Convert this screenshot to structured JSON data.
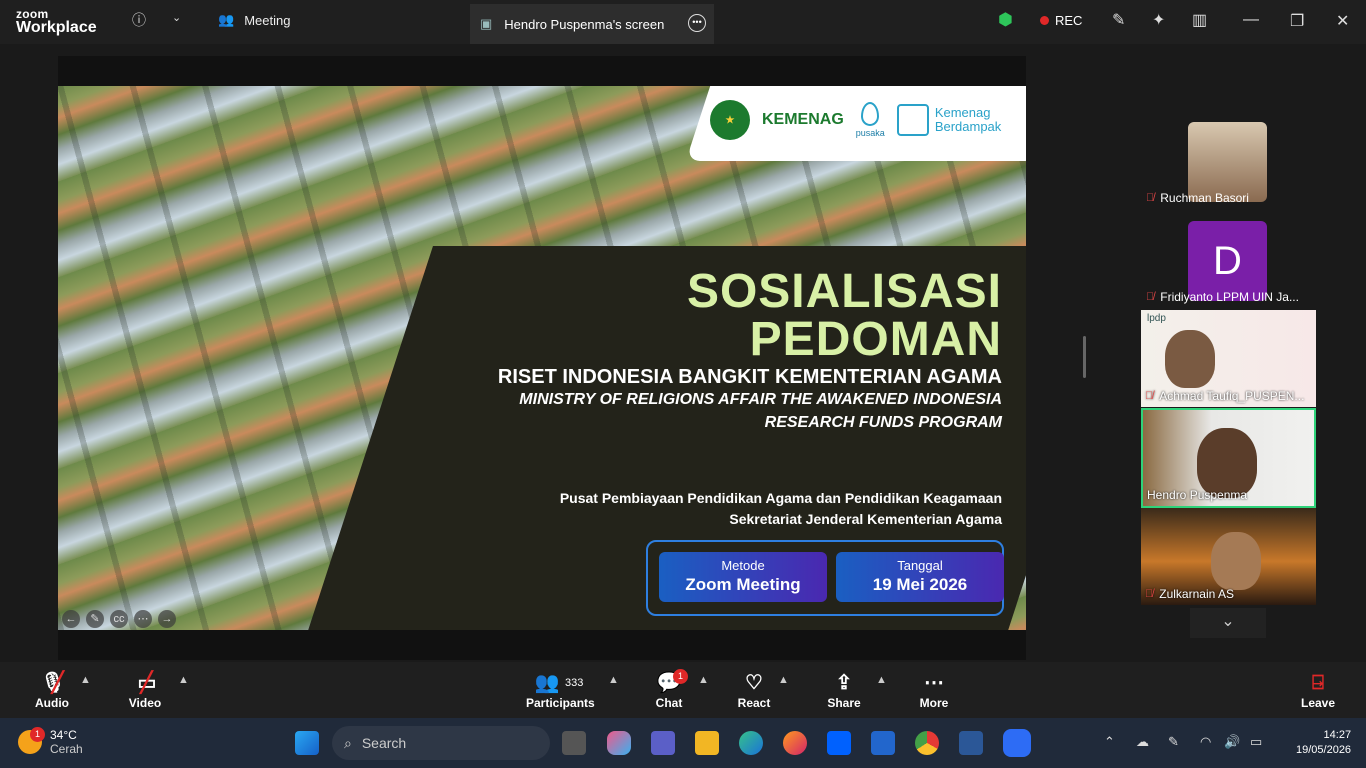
{
  "app": {
    "brand_line1": "zoom",
    "brand_line2": "Workplace"
  },
  "topbar": {
    "info_icon": "info-icon",
    "meeting_tab": "Meeting",
    "screen_tab": "Hendro Puspenma's screen",
    "rec_label": "REC"
  },
  "slide": {
    "logo_kemenag": "KEMENAG",
    "logo_pusaka": "pusaka",
    "logo_berdampak_1": "Kemenag",
    "logo_berdampak_2": "Berdampak",
    "title_line1": "SOSIALISASI",
    "title_line2": "PEDOMAN",
    "subtitle": "RISET INDONESIA BANGKIT KEMENTERIAN AGAMA",
    "subtitle_en_1": "MINISTRY OF RELIGIONS AFFAIR THE AWAKENED INDONESIA",
    "subtitle_en_2": "RESEARCH FUNDS PROGRAM",
    "org_1": "Pusat Pembiayaan Pendidikan Agama dan Pendidikan Keagamaan",
    "org_2": "Sekretariat Jenderal Kementerian Agama",
    "method_key": "Metode",
    "method_value": "Zoom Meeting",
    "date_key": "Tanggal",
    "date_value": "19 Mei 2026"
  },
  "participants_panel": [
    {
      "name": "Ruchman Basori"
    },
    {
      "name": "Fridiyanto LPPM UIN Ja...",
      "initial": "D"
    },
    {
      "name": "Achmad Taufiq_PUSPEN...",
      "bg_text": "lpdp"
    },
    {
      "name": "Hendro Puspenma"
    },
    {
      "name": "Zulkarnain AS"
    }
  ],
  "toolbar": {
    "audio": "Audio",
    "video": "Video",
    "participants": "Participants",
    "participants_count": "333",
    "chat": "Chat",
    "chat_badge": "1",
    "react": "React",
    "share": "Share",
    "more": "More",
    "leave": "Leave"
  },
  "taskbar": {
    "weather_badge": "1",
    "temperature": "34°C",
    "condition": "Cerah",
    "search_placeholder": "Search",
    "time": "14:27",
    "date": "19/05/2026"
  },
  "colors": {
    "accent_green": "#d8f0a6",
    "active_border": "#2ed37a",
    "rec_red": "#e02828"
  }
}
